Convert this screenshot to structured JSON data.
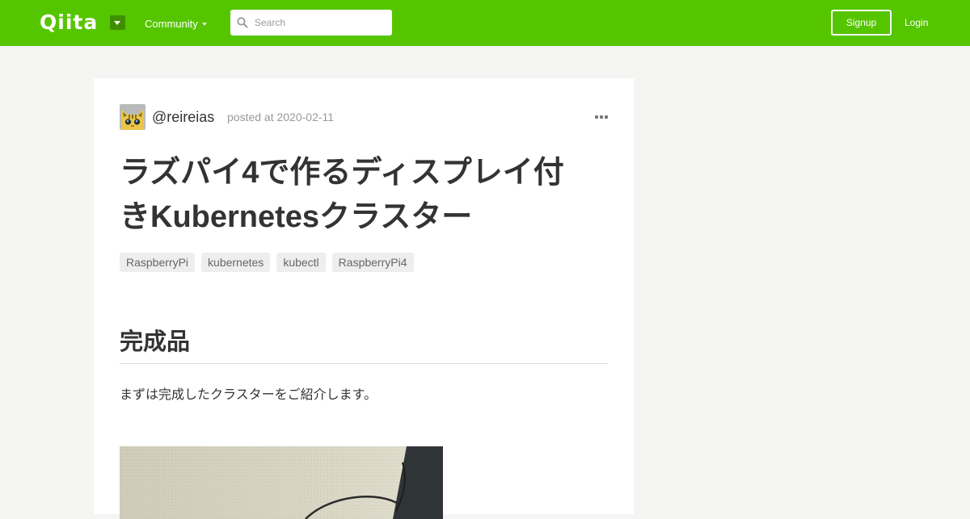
{
  "header": {
    "logo": "Qiita",
    "community_label": "Community",
    "search_placeholder": "Search",
    "signup_label": "Signup",
    "login_label": "Login",
    "brand_color": "#55c500"
  },
  "article": {
    "author": "@reireias",
    "posted": "posted at 2020-02-11",
    "title_line1": "ラズパイ4で作るディスプレイ付",
    "title_line2": "きKubernetesクラスター",
    "tags": [
      "RaspberryPi",
      "kubernetes",
      "kubectl",
      "RaspberryPi4"
    ],
    "section_heading": "完成品",
    "intro": "まずは完成したクラスターをご紹介します。"
  }
}
